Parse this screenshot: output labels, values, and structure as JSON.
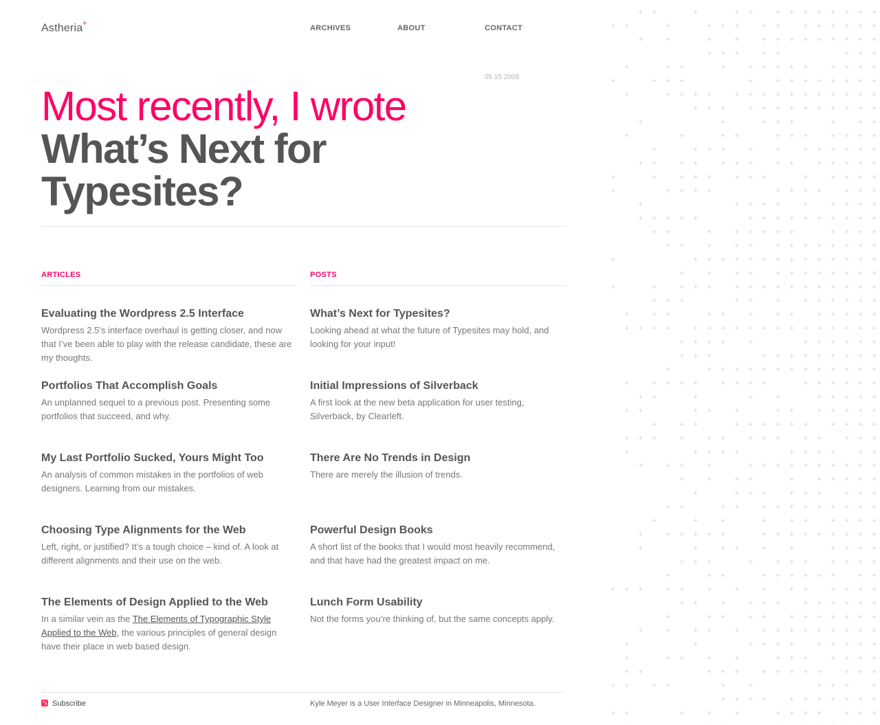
{
  "site": {
    "logo_text": "Astheria",
    "logo_mark": "+"
  },
  "nav": {
    "archives": "ARCHIVES",
    "about": "ABOUT",
    "contact": "CONTACT"
  },
  "hero": {
    "date": "05 15 2008",
    "intro": "Most recently, I wrote",
    "title": "What’s Next for Typesites?"
  },
  "articles": {
    "heading": "ARTICLES",
    "items": [
      {
        "title": "Evaluating the Wordpress 2.5 Interface",
        "desc": "Wordpress 2.5’s interface overhaul is getting closer, and now that I’ve been able to play with the release candidate, these are my thoughts."
      },
      {
        "title": "Portfolios That Accomplish Goals",
        "desc": "An unplanned sequel to a previous post. Presenting some portfolios that succeed, and why."
      },
      {
        "title": "My Last Portfolio Sucked, Yours Might Too",
        "desc": "An analysis of common mistakes in the portfolios of web designers. Learning from our mistakes."
      },
      {
        "title": "Choosing Type Alignments for the Web",
        "desc": "Left, right, or justified? It’s a tough choice – kind of. A look at different alignments and their use on the web."
      },
      {
        "title": "The Elements of Design Applied to the Web",
        "desc_before": "In a similar vein as the ",
        "desc_link": "The Elements of Typographic Style Applied to the Web",
        "desc_after": ", the various principles of general design have their place in web based design."
      }
    ]
  },
  "posts": {
    "heading": "POSTS",
    "items": [
      {
        "title": "What’s Next for Typesites?",
        "desc": "Looking ahead at what the future of Typesites may hold, and looking for your input!"
      },
      {
        "title": "Initial Impressions of Silverback",
        "desc": "A first look at the new beta application for user testing, Silverback, by Clearleft."
      },
      {
        "title": "There Are No Trends in Design",
        "desc": "There are merely the illusion of trends."
      },
      {
        "title": "Powerful Design Books",
        "desc": "A short list of the books that I would most heavily recommend, and that have had the greatest impact on me."
      },
      {
        "title": "Lunch Form Usability",
        "desc": "Not the forms you’re thinking of, but the same concepts apply."
      }
    ]
  },
  "footer": {
    "subscribe": "Subscribe",
    "bio": "Kyle Meyer is a User Interface Designer in Minneapolis, Minnesota."
  },
  "colors": {
    "accent": "#ff0066",
    "text": "#555555",
    "muted": "#777777",
    "pattern": "#d2d2d2"
  }
}
